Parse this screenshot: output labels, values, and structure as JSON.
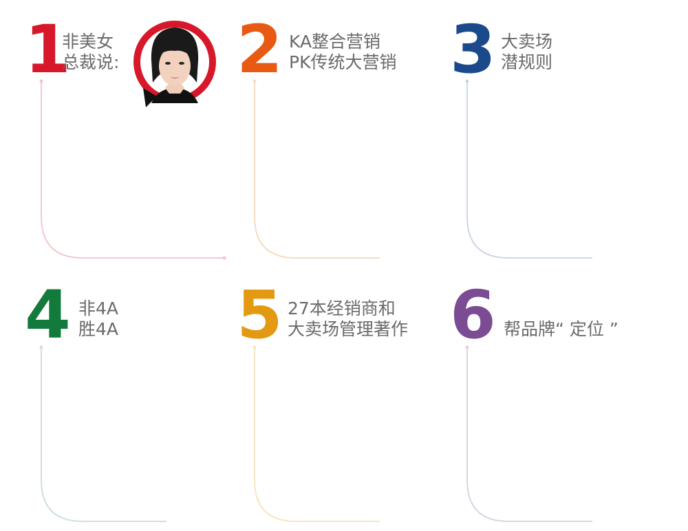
{
  "sections": [
    {
      "number": "1",
      "color": "#d7182a",
      "line_color": "#f4c7cc",
      "lines": [
        "非美女",
        "总裁说:"
      ]
    },
    {
      "number": "2",
      "color": "#e85a12",
      "line_color": "#f6dcc2",
      "lines": [
        "KA整合营销",
        "PK传统大营销"
      ]
    },
    {
      "number": "3",
      "color": "#1b4a8c",
      "line_color": "#cbd6e4",
      "lines": [
        "大卖场",
        "潜规则"
      ]
    },
    {
      "number": "4",
      "color": "#127a3a",
      "line_color": "#cfe0d6",
      "lines": [
        "非4A",
        "胜4A"
      ]
    },
    {
      "number": "5",
      "color": "#e39a12",
      "line_color": "#f6e6c2",
      "lines": [
        "27本经销商和",
        "大卖场管理著作"
      ]
    },
    {
      "number": "6",
      "color": "#7b4b94",
      "line_color": "#dcd3e3",
      "lines": [
        "帮品牌“ 定位 ”"
      ]
    }
  ],
  "avatar": {
    "icon": "woman-portrait-icon",
    "accent": "#d7182a"
  }
}
